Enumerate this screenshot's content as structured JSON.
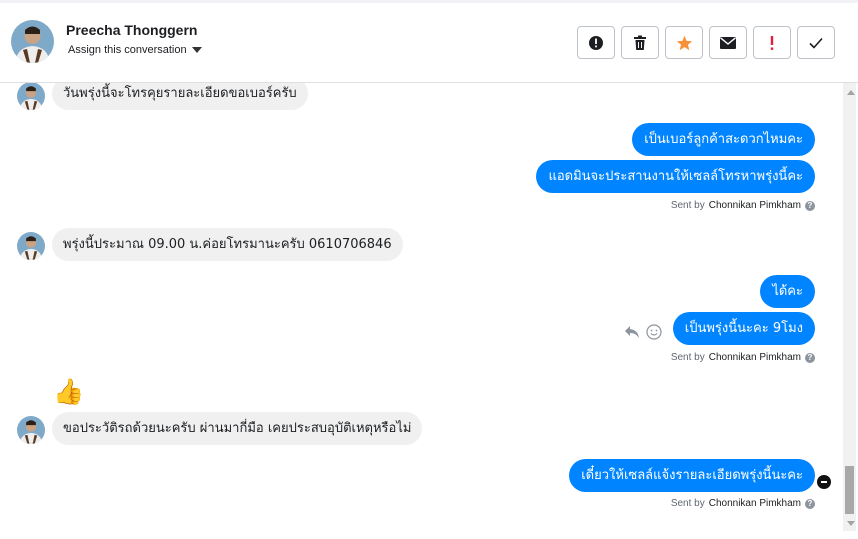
{
  "header": {
    "contact_name": "Preecha Thonggern",
    "assign_label": "Assign this conversation"
  },
  "toolbar": {
    "buttons": [
      {
        "name": "alert-icon",
        "color": "#1c1e21"
      },
      {
        "name": "trash-icon",
        "color": "#1c1e21"
      },
      {
        "name": "star-icon",
        "color": "#f7923b"
      },
      {
        "name": "envelope-icon",
        "color": "#1c1e21"
      },
      {
        "name": "exclamation-icon",
        "color": "#e41e3f"
      },
      {
        "name": "check-icon",
        "color": "#1c1e21"
      }
    ]
  },
  "colors": {
    "outgoing_bubble": "#0084ff",
    "incoming_bubble": "#f0f0f0"
  },
  "messages": [
    {
      "direction": "in",
      "text": "วันพรุ่งนี้จะโทรคุยรายละเอียดขอเบอร์ครับ"
    },
    {
      "direction": "out",
      "text": "เป็นเบอร์ลูกค้าสะดวกไหมคะ"
    },
    {
      "direction": "out",
      "text": "แอดมินจะประสานงานให้เซลล์โทรหาพรุ่งนี้คะ"
    },
    {
      "direction": "in",
      "text": "พรุ่งนี้ประมาณ 09.00 น.ค่อยโทรมานะครับ 0610706846"
    },
    {
      "direction": "out",
      "text": "ได้คะ"
    },
    {
      "direction": "out",
      "text": "เป็นพรุ่งนี้นะคะ 9โมง"
    },
    {
      "direction": "in",
      "text": "👍"
    },
    {
      "direction": "in",
      "text": "ขอประวัติรถด้วยนะครับ ผ่านมากี่มือ เคยประสบอุบัติเหตุหรือไม่"
    },
    {
      "direction": "out",
      "text": "เดี๋ยวให้เซลล์แจ้งรายละเอียดพรุ่งนี้นะคะ"
    }
  ],
  "sent_by": {
    "prefix": "Sent by",
    "agent": "Chonnikan Pimkham"
  },
  "message_tools": [
    "reply-icon",
    "emoji-icon"
  ]
}
